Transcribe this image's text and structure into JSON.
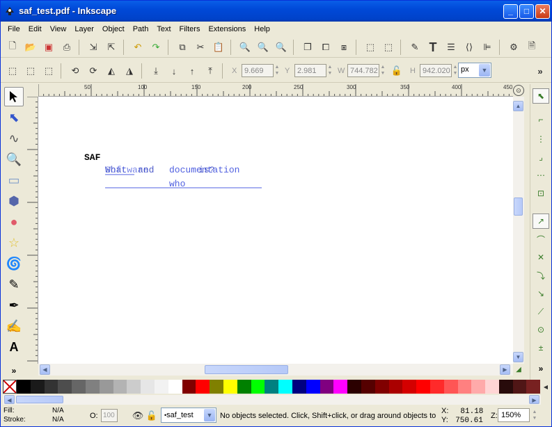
{
  "window": {
    "title": "saf_test.pdf - Inkscape"
  },
  "menu": [
    "File",
    "Edit",
    "View",
    "Layer",
    "Object",
    "Path",
    "Text",
    "Filters",
    "Extensions",
    "Help"
  ],
  "toolbar_controls": {
    "x_label": "X",
    "x_value": "9.669",
    "y_label": "Y",
    "y_value": "2.981",
    "w_label": "W",
    "w_value": "744.782",
    "h_label": "H",
    "h_value": "942.020",
    "unit": "px"
  },
  "ruler": {
    "h_ticks": [
      "50",
      "100",
      "150",
      "200",
      "250",
      "300",
      "350",
      "400",
      "450"
    ]
  },
  "canvas_text": {
    "heading": "SAF",
    "line1_a": "What",
    "line1_b": "Software",
    "line1_c": "documentation",
    "line1_d": "is?",
    "line1_e": "and",
    "line2": "who"
  },
  "palette": [
    "#000000",
    "#1a1a1a",
    "#333333",
    "#4d4d4d",
    "#666666",
    "#808080",
    "#999999",
    "#b3b3b3",
    "#cccccc",
    "#e6e6e6",
    "#f2f2f2",
    "#ffffff",
    "#800000",
    "#ff0000",
    "#808000",
    "#ffff00",
    "#008000",
    "#00ff00",
    "#008080",
    "#00ffff",
    "#000080",
    "#0000ff",
    "#800080",
    "#ff00ff",
    "#2b0000",
    "#550000",
    "#800000",
    "#aa0000",
    "#d40000",
    "#ff0000",
    "#ff2a2a",
    "#ff5555",
    "#ff8080",
    "#ffaaaa",
    "#ffd5d5",
    "#280b0b",
    "#501616",
    "#782121"
  ],
  "status": {
    "fill_label": "Fill:",
    "fill_value": "N/A",
    "stroke_label": "Stroke:",
    "stroke_value": "N/A",
    "opacity_label": "O:",
    "opacity_value": "100",
    "layer": "saf_test",
    "message": "No objects selected. Click, Shift+click, or drag around objects to select.",
    "x_label": "X:",
    "x_value": "81.18",
    "y_label": "Y:",
    "y_value": "750.61",
    "zoom_label": "Z:",
    "zoom_value": "150%"
  }
}
